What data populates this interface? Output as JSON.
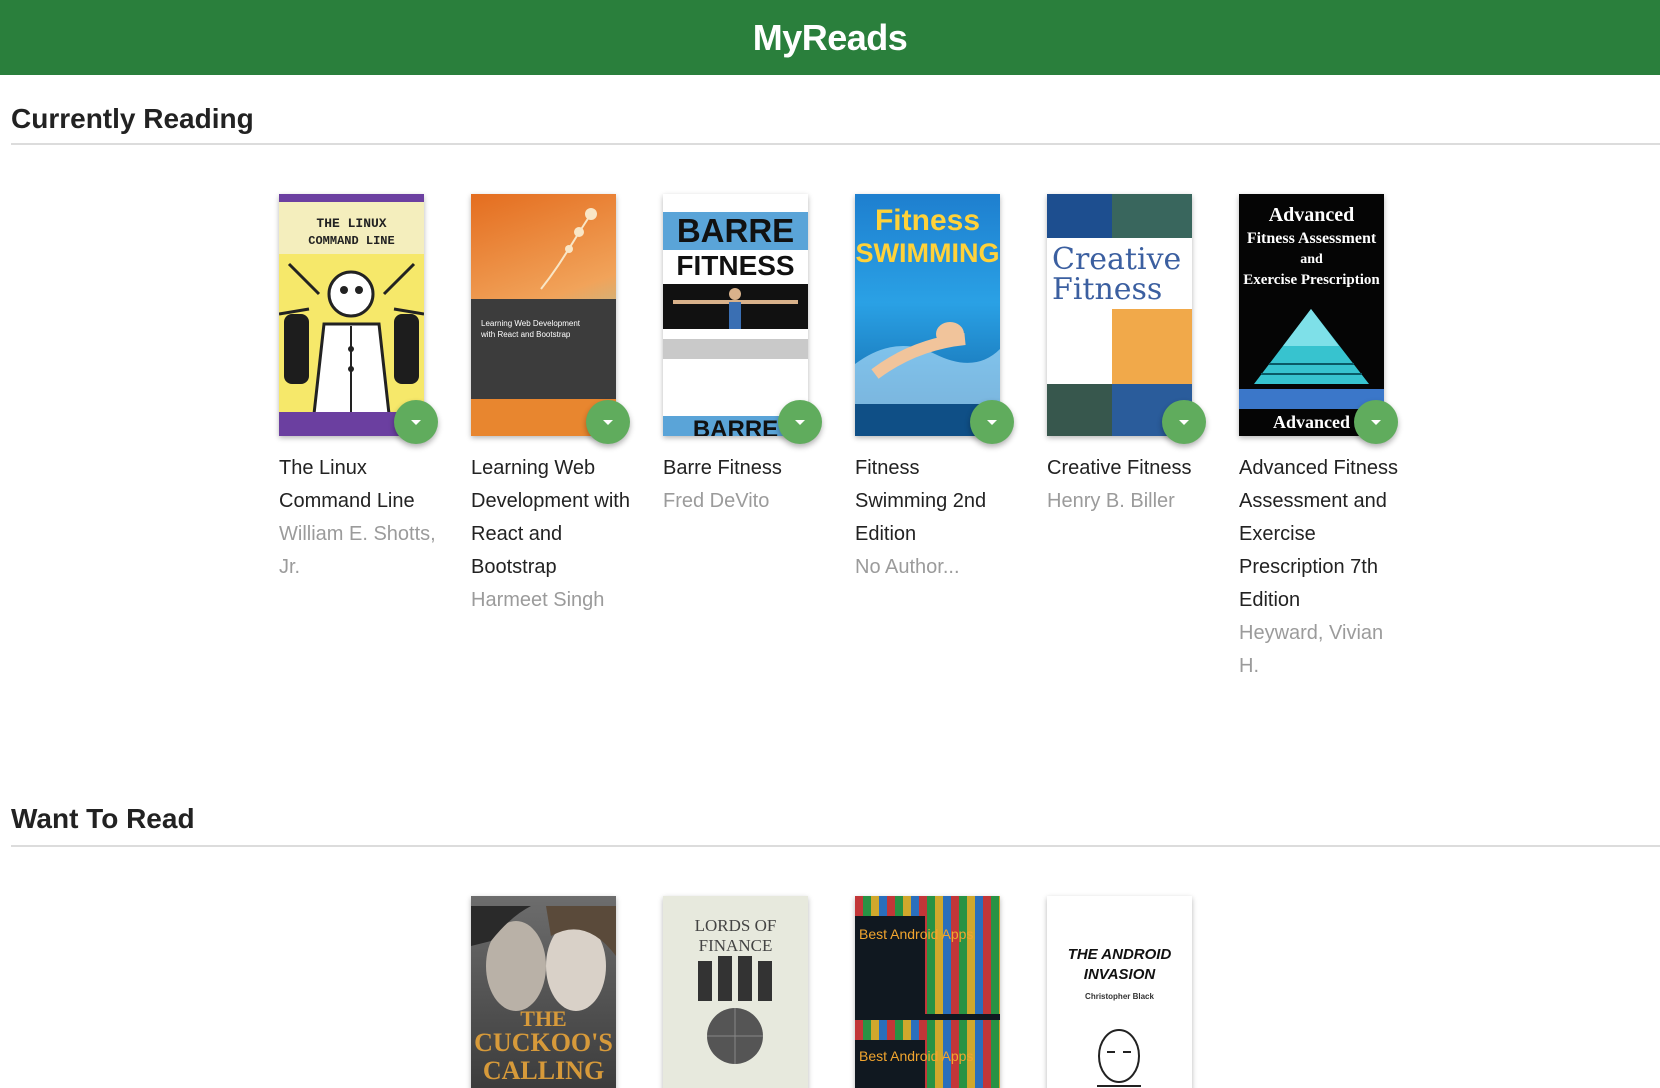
{
  "header": {
    "title": "MyReads"
  },
  "shelves": [
    {
      "title": "Currently Reading",
      "books": [
        {
          "title": "The Linux Command Line",
          "authors": "William E. Shotts, Jr.",
          "cover": {
            "line1": "THE LINUX",
            "line2": "COMMAND LINE"
          }
        },
        {
          "title": "Learning Web Development with React and Bootstrap",
          "authors": "Harmeet Singh",
          "cover": {
            "line1": "Learning Web Development",
            "line2": "with React and Bootstrap"
          }
        },
        {
          "title": "Barre Fitness",
          "authors": "Fred DeVito",
          "cover": {
            "line1": "BARRE",
            "line2": "FITNESS",
            "line3": "BARRE"
          }
        },
        {
          "title": "Fitness Swimming 2nd Edition",
          "authors": "No Author...",
          "cover": {
            "line1": "Fitness",
            "line2": "SWIMMING"
          }
        },
        {
          "title": "Creative Fitness",
          "authors": "Henry B. Biller",
          "cover": {
            "line1": "Creative",
            "line2": "Fitness"
          }
        },
        {
          "title": "Advanced Fitness Assessment and Exercise Prescription 7th Edition",
          "authors": "Heyward, Vivian H.",
          "cover": {
            "line1": "Advanced",
            "line2": "Fitness Assessment",
            "line3": "and",
            "line4": "Exercise Prescription",
            "line5": "Advanced"
          }
        }
      ]
    },
    {
      "title": "Want To Read",
      "books": [
        {
          "cover": {
            "line1": "THE",
            "line2": "CUCKOO'S",
            "line3": "CALLING"
          }
        },
        {
          "cover": {
            "line1": "LORDS OF FINANCE"
          }
        },
        {
          "cover": {
            "line1": "Best Android Apps",
            "line2": "Best Android Apps"
          }
        },
        {
          "cover": {
            "line1": "THE ANDROID",
            "line2": "INVASION",
            "line3": "Christopher Black"
          }
        }
      ]
    }
  ],
  "colors": {
    "header_bg": "#2a7f3c",
    "changer_bg": "#60ac5d",
    "author_text": "#9b9b9b"
  },
  "icons": {
    "shelf_changer": "caret-down-icon"
  }
}
